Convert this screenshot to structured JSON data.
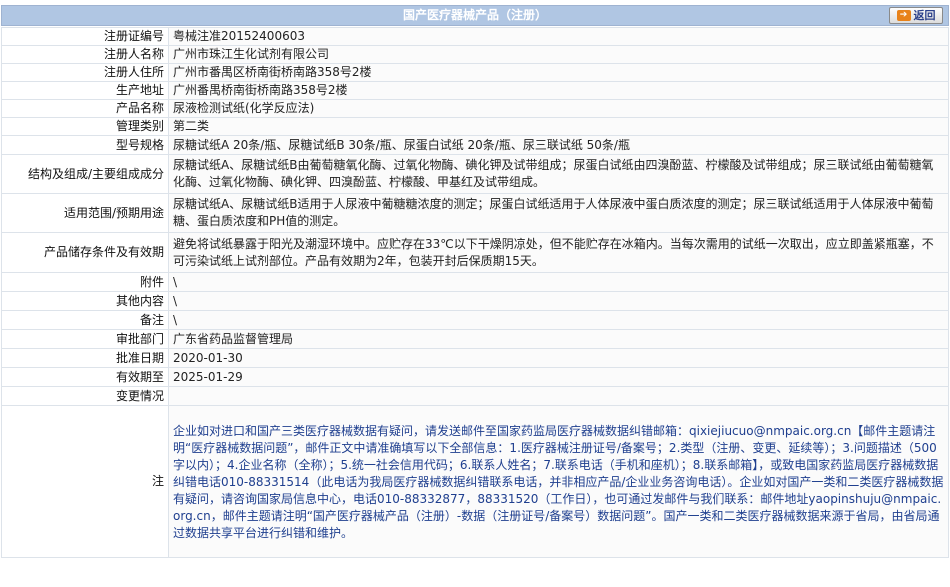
{
  "header": {
    "title": "国产医疗器械产品（注册）",
    "back_label": "返回"
  },
  "rows": [
    {
      "label": "注册证编号",
      "value": "粤械注准20152400603"
    },
    {
      "label": "注册人名称",
      "value": "广州市珠江生化试剂有限公司"
    },
    {
      "label": "注册人住所",
      "value": "广州市番禺区桥南街桥南路358号2楼"
    },
    {
      "label": "生产地址",
      "value": "广州番禺桥南街桥南路358号2楼"
    },
    {
      "label": "产品名称",
      "value": "尿液检测试纸(化学反应法)"
    },
    {
      "label": "管理类别",
      "value": "第二类"
    },
    {
      "label": "型号规格",
      "value": "尿糖试纸A 20条/瓶、尿糖试纸B 30条/瓶、尿蛋白试纸 20条/瓶、尿三联试纸 50条/瓶"
    },
    {
      "label": "结构及组成/主要组成成分",
      "value": "尿糖试纸A、尿糖试纸B由葡萄糖氧化酶、过氧化物酶、碘化钾及试带组成；尿蛋白试纸由四溴酚蓝、柠檬酸及试带组成；尿三联试纸由葡萄糖氧化酶、过氧化物酶、碘化钾、四溴酚蓝、柠檬酸、甲基红及试带组成。"
    },
    {
      "label": "适用范围/预期用途",
      "value": "尿糖试纸A、尿糖试纸B适用于人尿液中葡糖糖浓度的测定；尿蛋白试纸适用于人体尿液中蛋白质浓度的测定；尿三联试纸适用于人体尿液中葡萄糖、蛋白质浓度和PH值的测定。"
    },
    {
      "label": "产品储存条件及有效期",
      "value": "避免将试纸暴露于阳光及潮湿环境中。应贮存在33℃以下干燥阴凉处，但不能贮存在冰箱内。当每次需用的试纸一次取出，应立即盖紧瓶塞，不可污染试纸上试剂部位。产品有效期为2年，包装开封后保质期15天。"
    },
    {
      "label": "附件",
      "value": "\\"
    },
    {
      "label": "其他内容",
      "value": "\\"
    },
    {
      "label": "备注",
      "value": "\\"
    },
    {
      "label": "审批部门",
      "value": "广东省药品监督管理局"
    },
    {
      "label": "批准日期",
      "value": "2020-01-30"
    },
    {
      "label": "有效期至",
      "value": "2025-01-29"
    },
    {
      "label": "变更情况",
      "value": ""
    }
  ],
  "note": {
    "label": "注",
    "text": "企业如对进口和国产三类医疗器械数据有疑问，请发送邮件至国家药监局医疗器械数据纠错邮箱：qixiejiucuo@nmpaic.org.cn【邮件主题请注明“医疗器械数据问题”，邮件正文中请准确填写以下全部信息：1.医疗器械注册证号/备案号；2.类型（注册、变更、延续等）；3.问题描述（500字以内）；4.企业名称（全称）；5.统一社会信用代码；6.联系人姓名；7.联系电话（手机和座机）；8.联系邮箱】，或致电国家药监局医疗器械数据纠错电话010-88331514（此电话为我局医疗器械数据纠错联系电话，并非相应产品/企业业务咨询电话）。企业如对国产一类和二类医疗器械数据有疑问，请咨询国家局信息中心，电话010-88332877，88331520（工作日），也可通过发邮件与我们联系：邮件地址yaopinshuju@nmpaic.org.cn，邮件主题请注明“国产医疗器械产品（注册）-数据（注册证号/备案号）数据问题”。国产一类和二类医疗器械数据来源于省局，由省局通过数据共享平台进行纠错和维护。"
  },
  "icons": {
    "back": "back-arrow-icon"
  },
  "colors": {
    "header_bg": "#b0c6e3",
    "note_text": "#1f3f8f",
    "border": "#dde3ea"
  }
}
